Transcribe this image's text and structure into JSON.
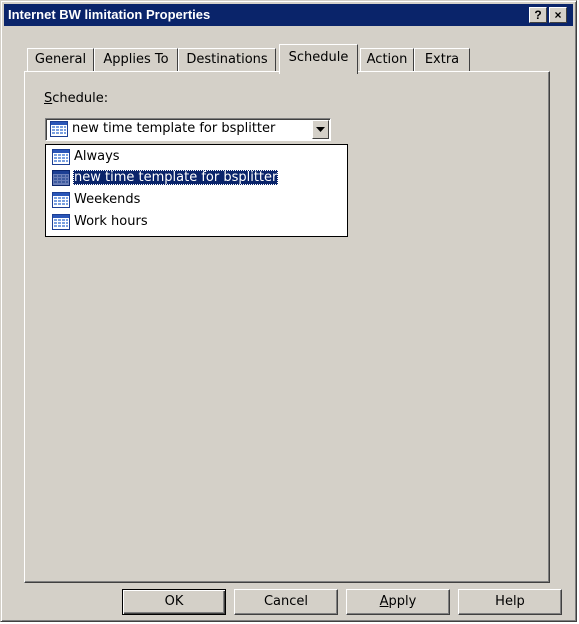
{
  "window": {
    "title": "Internet BW limitation Properties",
    "help_glyph": "?",
    "close_glyph": "×"
  },
  "tabs": [
    {
      "label": "General"
    },
    {
      "label": "Applies To"
    },
    {
      "label": "Destinations"
    },
    {
      "label": "Schedule",
      "active": true
    },
    {
      "label": "Action"
    },
    {
      "label": "Extra"
    }
  ],
  "schedule": {
    "label_mnemonic": "S",
    "label_rest": "chedule:",
    "selected_value": "new time template for bsplitter",
    "options": [
      {
        "label": "Always"
      },
      {
        "label": "new time template for bsplitter",
        "highlighted": true
      },
      {
        "label": "Weekends"
      },
      {
        "label": "Work hours"
      }
    ]
  },
  "buttons": {
    "ok": "OK",
    "cancel": "Cancel",
    "apply_mnemonic": "A",
    "apply_rest": "pply",
    "help": "Help"
  },
  "colors": {
    "titlebar": "#0a246a",
    "face": "#d4d0c8",
    "selection": "#0a246a"
  },
  "icons": {
    "option_icon": "calendar-icon",
    "combo_arrow": "chevron-down-icon"
  }
}
